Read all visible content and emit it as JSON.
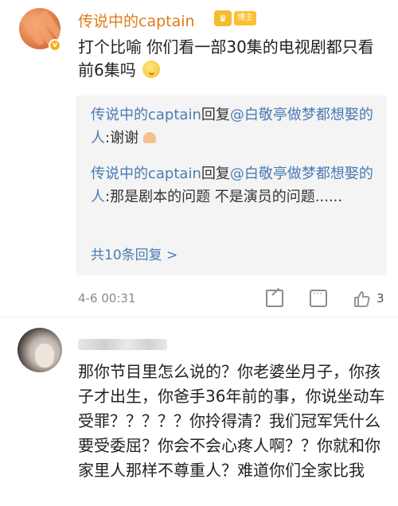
{
  "top_comment": {
    "username": "传说中的captain",
    "badge": "博主",
    "text": "打个比喻 你们看一部30集的电视剧都只看前6集吗",
    "replies": [
      {
        "author": "传说中的captain",
        "action": "回复",
        "mention": "@白敬亭做梦都想娶的人",
        "text": ":谢谢"
      },
      {
        "author": "传说中的captain",
        "action": "回复",
        "mention": "@白敬亭做梦都想娶的人",
        "text": ":那是剧本的问题 不是演员的问题......"
      }
    ],
    "more_replies": "共10条回复 >",
    "timestamp": "4-6 00:31",
    "like_count": "3",
    "icons": [
      "share-icon",
      "comment-icon",
      "like-icon",
      "emoji-icon",
      "clap-emoji-icon",
      "vip-crown-icon"
    ]
  },
  "second_comment": {
    "text": "那你节目里怎么说的？你老婆坐月子，你孩子才出生，你爸手36年前的事，你说坐动车受罪？？？？？你拎得清？我们冠军凭什么要受委屈？你会不会心疼人啊？？你就和你家里人那样不尊重人？难道你们全家比我"
  },
  "colors": {
    "username": "#e07a18",
    "link": "#4a7bb5",
    "reply_bg": "#f4f4f4",
    "meta": "#8a8a8a"
  }
}
